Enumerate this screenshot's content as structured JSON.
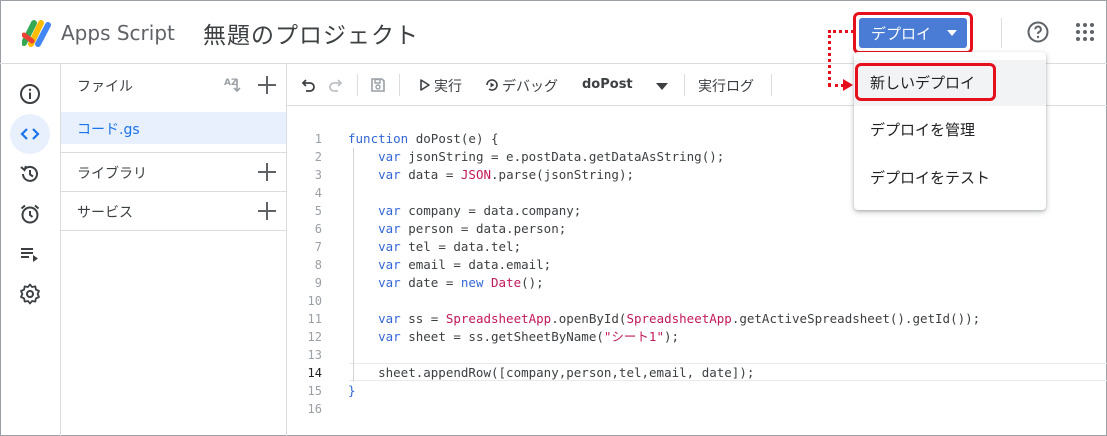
{
  "header": {
    "app_name": "Apps Script",
    "project_title": "無題のプロジェクト",
    "deploy_label": "デプロイ"
  },
  "deploy_menu": {
    "items": [
      {
        "label": "新しいデプロイ"
      },
      {
        "label": "デプロイを管理"
      },
      {
        "label": "デプロイをテスト"
      }
    ]
  },
  "files_panel": {
    "title": "ファイル",
    "sort_label": "AZ",
    "files": [
      {
        "name": "コード.gs"
      }
    ],
    "sections": [
      {
        "label": "ライブラリ"
      },
      {
        "label": "サービス"
      }
    ]
  },
  "toolbar": {
    "run_label": "実行",
    "debug_label": "デバッグ",
    "function_selected": "doPost",
    "log_label": "実行ログ"
  },
  "editor": {
    "active_line": 14,
    "line_numbers": [
      "1",
      "2",
      "3",
      "4",
      "5",
      "6",
      "7",
      "8",
      "9",
      "10",
      "11",
      "12",
      "13",
      "14",
      "15",
      "16"
    ]
  },
  "colors": {
    "accent_blue": "#4a7cd6",
    "highlight_red": "#e5101c",
    "keyword_blue": "#3367d6",
    "class_pink": "#c2185b"
  },
  "icons": {
    "rail": [
      "info-icon",
      "code-icon",
      "history-icon",
      "alarm-icon",
      "executions-icon",
      "settings-icon"
    ],
    "toolbar": [
      "undo-icon",
      "redo-icon",
      "save-icon",
      "run-icon",
      "debug-icon"
    ]
  }
}
